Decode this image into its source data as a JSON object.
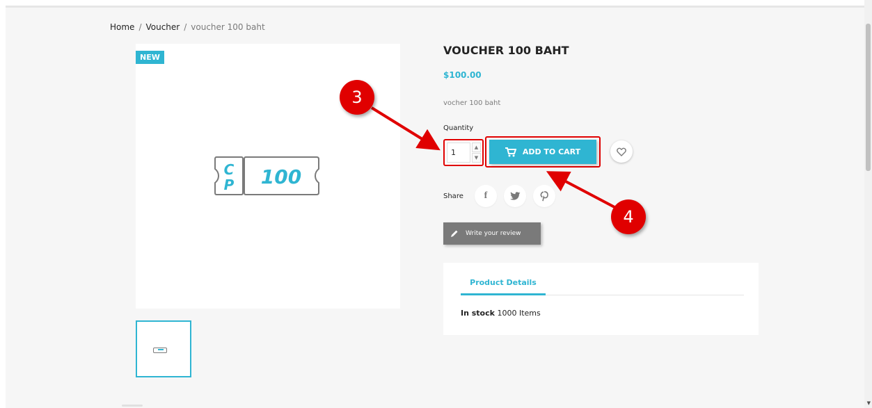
{
  "breadcrumb": {
    "home": "Home",
    "separator": "/",
    "category": "Voucher",
    "current": "voucher 100 baht"
  },
  "product": {
    "badge": "NEW",
    "title": "VOUCHER 100 BAHT",
    "price": "$100.00",
    "description": "vocher 100 baht",
    "quantity_label": "Quantity",
    "quantity_value": "1",
    "add_to_cart": "ADD TO CART",
    "share_label": "Share",
    "share_icons": [
      "facebook-icon",
      "twitter-icon",
      "pinterest-icon"
    ],
    "review_button": "Write your review",
    "voucher_letters": [
      "C",
      "P"
    ],
    "voucher_amount": "100"
  },
  "details": {
    "tab": "Product Details",
    "stock_label": "In stock",
    "stock_value": "1000 Items"
  },
  "annotations": {
    "callout_quantity": "3",
    "callout_cart": "4"
  },
  "colors": {
    "accent": "#2fb5d2",
    "annotation": "#e00000",
    "review_button": "#7a7a7a"
  }
}
